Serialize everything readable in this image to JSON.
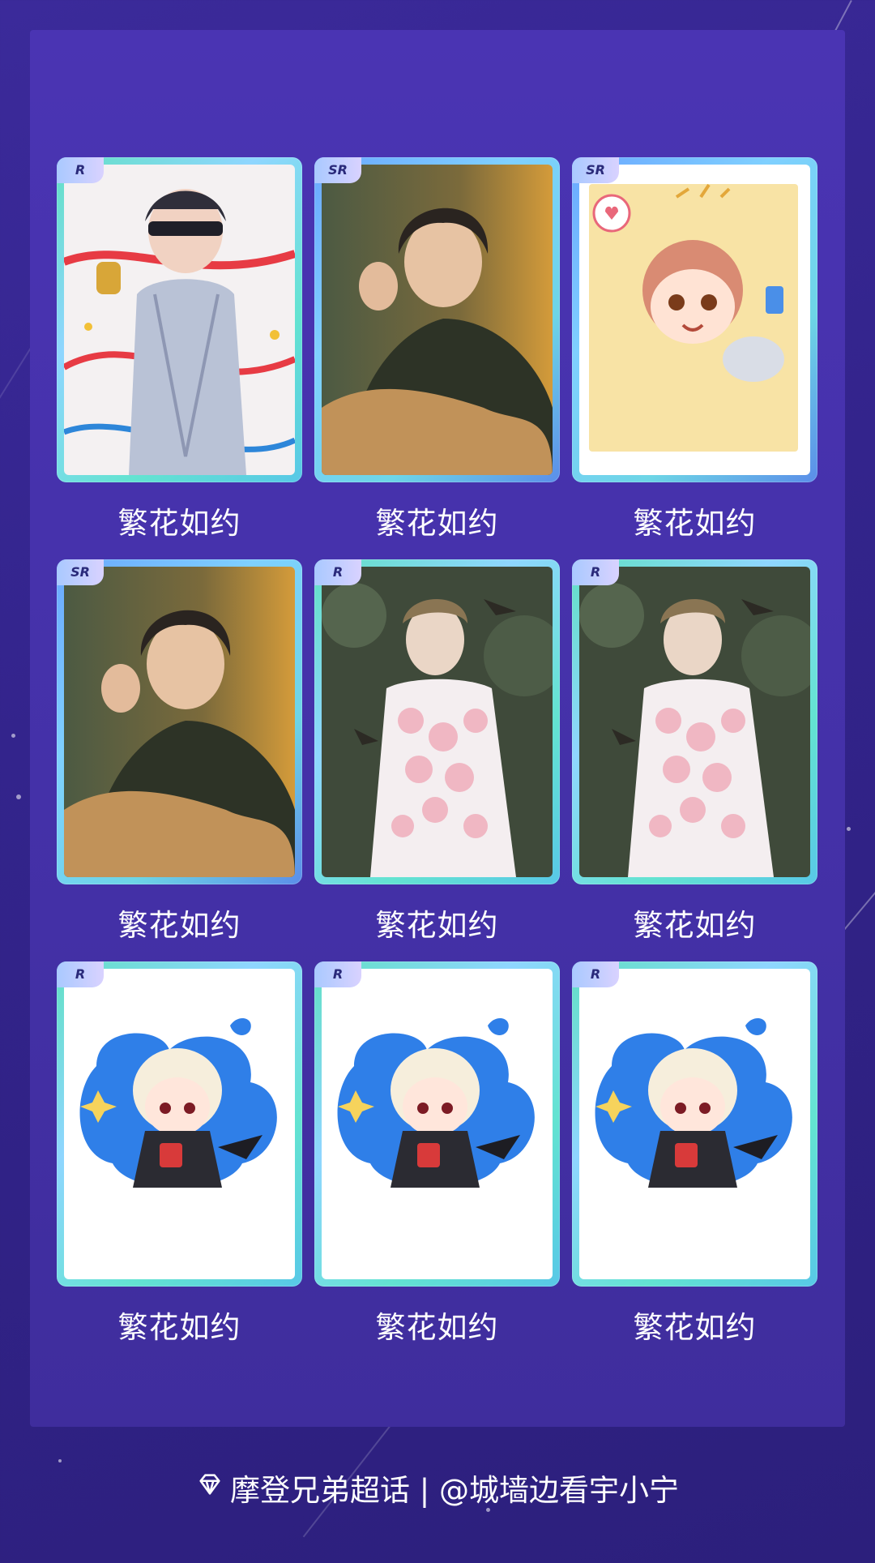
{
  "cards": [
    {
      "rarity": "R",
      "label": "繁花如约",
      "art": "sleep-mask-performer"
    },
    {
      "rarity": "SR",
      "label": "繁花如约",
      "art": "painted-portrait-dark-sweater"
    },
    {
      "rarity": "SR",
      "label": "繁花如约",
      "art": "chibi-sticker-collage"
    },
    {
      "rarity": "SR",
      "label": "繁花如约",
      "art": "painted-portrait-dark-sweater"
    },
    {
      "rarity": "R",
      "label": "繁花如约",
      "art": "floral-portrait-birds"
    },
    {
      "rarity": "R",
      "label": "繁花如约",
      "art": "floral-portrait-birds"
    },
    {
      "rarity": "R",
      "label": "繁花如约",
      "art": "chibi-vampire-blue-splash"
    },
    {
      "rarity": "R",
      "label": "繁花如约",
      "art": "chibi-vampire-blue-splash"
    },
    {
      "rarity": "R",
      "label": "繁花如约",
      "art": "chibi-vampire-blue-splash"
    }
  ],
  "footer": {
    "icon": "diamond-icon",
    "text": "摩登兄弟超话 | @城墙边看宇小宁"
  },
  "colors": {
    "background": "#33248c",
    "panel": "#4431a8",
    "frame_r": "#61e0c4",
    "frame_sr": "#6aa7ff"
  }
}
